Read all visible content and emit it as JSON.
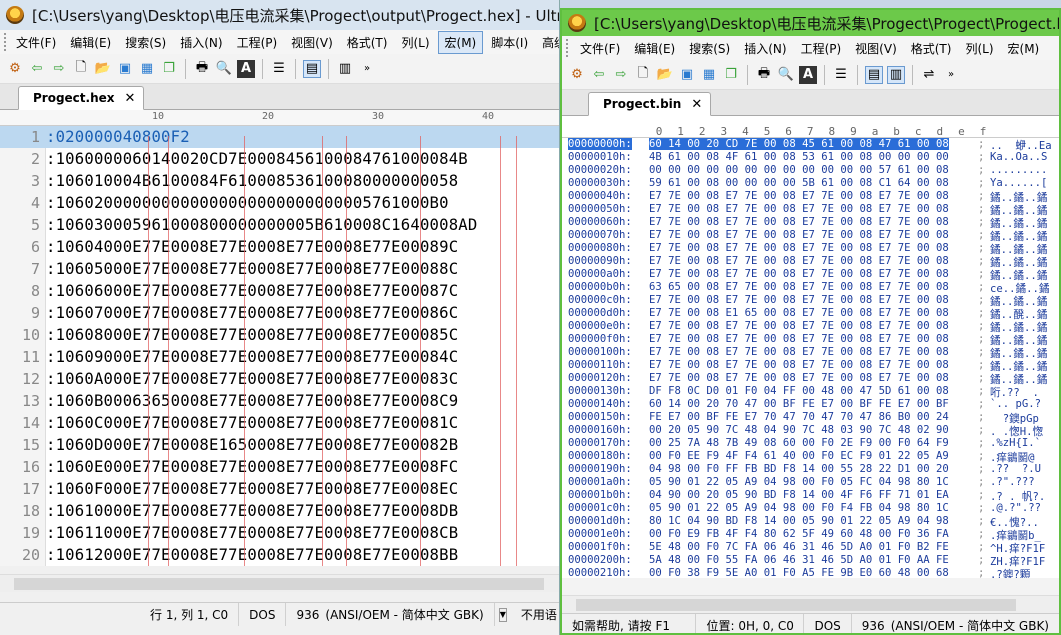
{
  "win1": {
    "title": "[C:\\Users\\yang\\Desktop\\电压电流采集\\Progect\\output\\Progect.hex] - Ultra",
    "menu": [
      "文件(F)",
      "编辑(E)",
      "搜索(S)",
      "插入(N)",
      "工程(P)",
      "视图(V)",
      "格式(T)",
      "列(L)",
      "宏(M)",
      "脚本(I)",
      "高级"
    ],
    "tab": "Progect.hex",
    "ruler": [
      "10",
      "20",
      "30",
      "40"
    ],
    "lines": [
      {
        "n": "1",
        "t": ":020000040800F2"
      },
      {
        "n": "2",
        "t": ":1060000060140020CD7E0008456100084761000084B"
      },
      {
        "n": "3",
        "t": ":106010004B6100084F610008536100080000000058"
      },
      {
        "n": "4",
        "t": ":106020000000000000000000000000005761000B0"
      },
      {
        "n": "5",
        "t": ":106030005961000800000000005B610008C1640008AD"
      },
      {
        "n": "6",
        "t": ":10604000E77E0008E77E0008E77E0008E77E00089C"
      },
      {
        "n": "7",
        "t": ":10605000E77E0008E77E0008E77E0008E77E00088C"
      },
      {
        "n": "8",
        "t": ":10606000E77E0008E77E0008E77E0008E77E00087C"
      },
      {
        "n": "9",
        "t": ":10607000E77E0008E77E0008E77E0008E77E00086C"
      },
      {
        "n": "10",
        "t": ":10608000E77E0008E77E0008E77E0008E77E00085C"
      },
      {
        "n": "11",
        "t": ":10609000E77E0008E77E0008E77E0008E77E00084C"
      },
      {
        "n": "12",
        "t": ":1060A000E77E0008E77E0008E77E0008E77E00083C"
      },
      {
        "n": "13",
        "t": ":1060B00063650008E77E0008E77E0008E77E0008C9"
      },
      {
        "n": "14",
        "t": ":1060C000E77E0008E77E0008E77E0008E77E00081C"
      },
      {
        "n": "15",
        "t": ":1060D000E77E0008E1650008E77E0008E77E00082B"
      },
      {
        "n": "16",
        "t": ":1060E000E77E0008E77E0008E77E0008E77E0008FC"
      },
      {
        "n": "17",
        "t": ":1060F000E77E0008E77E0008E77E0008E77E0008EC"
      },
      {
        "n": "18",
        "t": ":10610000E77E0008E77E0008E77E0008E77E0008DB"
      },
      {
        "n": "19",
        "t": ":10611000E77E0008E77E0008E77E0008E77E0008CB"
      },
      {
        "n": "20",
        "t": ":10612000E77E0008E77E0008E77E0008E77E0008BB"
      }
    ],
    "status": {
      "pos": "行 1, 列 1, C0",
      "format": "DOS",
      "codepage": "936",
      "encoding": "(ANSI/OEM - 简体中文 GBK)",
      "extra": "不用语"
    }
  },
  "win2": {
    "title": "[C:\\Users\\yang\\Desktop\\电压电流采集\\Progect\\Progect\\Progect.b",
    "menu": [
      "文件(F)",
      "编辑(E)",
      "搜索(S)",
      "插入(N)",
      "工程(P)",
      "视图(V)",
      "格式(T)",
      "列(L)",
      "宏(M)"
    ],
    "tab": "Progect.bin",
    "cols": [
      "0",
      "1",
      "2",
      "3",
      "4",
      "5",
      "6",
      "7",
      "8",
      "9",
      "a",
      "b",
      "c",
      "d",
      "e",
      "f"
    ],
    "rows": [
      {
        "a": "00000000h:",
        "b": "60 14 00 20 CD 7E 00 08 45 61 00 08 47 61 00 08",
        "s": "..  蛜..Ea"
      },
      {
        "a": "00000010h:",
        "b": "4B 61 00 08 4F 61 00 08 53 61 00 08 00 00 00 00",
        "s": "Ka..Oa..S"
      },
      {
        "a": "00000020h:",
        "b": "00 00 00 00 00 00 00 00 00 00 00 00 57 61 00 08",
        "s": "........."
      },
      {
        "a": "00000030h:",
        "b": "59 61 00 08 00 00 00 00 5B 61 00 08 C1 64 00 08",
        "s": "Ya......["
      },
      {
        "a": "00000040h:",
        "b": "E7 7E 00 08 E7 7E 00 08 E7 7E 00 08 E7 7E 00 08",
        "s": "鐍..鐍..鐍"
      },
      {
        "a": "00000050h:",
        "b": "E7 7E 00 08 E7 7E 00 08 E7 7E 00 08 E7 7E 00 08",
        "s": "鐍..鐍..鐍"
      },
      {
        "a": "00000060h:",
        "b": "E7 7E 00 08 E7 7E 00 08 E7 7E 00 08 E7 7E 00 08",
        "s": "鐍..鐍..鐍"
      },
      {
        "a": "00000070h:",
        "b": "E7 7E 00 08 E7 7E 00 08 E7 7E 00 08 E7 7E 00 08",
        "s": "鐍..鐍..鐍"
      },
      {
        "a": "00000080h:",
        "b": "E7 7E 00 08 E7 7E 00 08 E7 7E 00 08 E7 7E 00 08",
        "s": "鐍..鐍..鐍"
      },
      {
        "a": "00000090h:",
        "b": "E7 7E 00 08 E7 7E 00 08 E7 7E 00 08 E7 7E 00 08",
        "s": "鐍..鐍..鐍"
      },
      {
        "a": "000000a0h:",
        "b": "E7 7E 00 08 E7 7E 00 08 E7 7E 00 08 E7 7E 00 08",
        "s": "鐍..鐍..鐍"
      },
      {
        "a": "000000b0h:",
        "b": "63 65 00 08 E7 7E 00 08 E7 7E 00 08 E7 7E 00 08",
        "s": "ce..鐍..鐍"
      },
      {
        "a": "000000c0h:",
        "b": "E7 7E 00 08 E7 7E 00 08 E7 7E 00 08 E7 7E 00 08",
        "s": "鐍..鐍..鐍"
      },
      {
        "a": "000000d0h:",
        "b": "E7 7E 00 08 E1 65 00 08 E7 7E 00 08 E7 7E 00 08",
        "s": "鐍..醗..鐍"
      },
      {
        "a": "000000e0h:",
        "b": "E7 7E 00 08 E7 7E 00 08 E7 7E 00 08 E7 7E 00 08",
        "s": "鐍..鐍..鐍"
      },
      {
        "a": "000000f0h:",
        "b": "E7 7E 00 08 E7 7E 00 08 E7 7E 00 08 E7 7E 00 08",
        "s": "鐍..鐍..鐍"
      },
      {
        "a": "00000100h:",
        "b": "E7 7E 00 08 E7 7E 00 08 E7 7E 00 08 E7 7E 00 08",
        "s": "鐍..鐍..鐍"
      },
      {
        "a": "00000110h:",
        "b": "E7 7E 00 08 E7 7E 00 08 E7 7E 00 08 E7 7E 00 08",
        "s": "鐍..鐍..鐍"
      },
      {
        "a": "00000120h:",
        "b": "E7 7E 00 08 E7 7E 00 08 E7 7E 00 08 E7 7E 00 08",
        "s": "鐍..鐍..鐍"
      },
      {
        "a": "00000130h:",
        "b": "DF F8 0C D0 01 F0 04 FF 00 48 00 47 5D 61 00 08",
        "s": "哘.??  ."
      },
      {
        "a": "00000140h:",
        "b": "60 14 00 20 70 47 00 BF FE E7 00 BF FE E7 00 BF",
        "s": "`.. pG.?"
      },
      {
        "a": "00000150h:",
        "b": "FE E7 00 BF FE E7 70 47 70 47 70 47 86 B0 00 24",
        "s": "  ?鐭pGp"
      },
      {
        "a": "00000160h:",
        "b": "00 20 05 90 7C 48 04 90 7C 48 03 90 7C 48 02 90",
        "s": ". .愡H.愡"
      },
      {
        "a": "00000170h:",
        "b": "00 25 7A 48 7B 49 08 60 00 F0 2E F9 00 F0 64 F9",
        "s": ".%zH{I.`"
      },
      {
        "a": "00000180h:",
        "b": "00 F0 EE F9 4F F4 61 40 00 F0 EC F9 01 22 05 A9",
        "s": ".痒鶲鬭@"
      },
      {
        "a": "00000190h:",
        "b": "04 98 00 F0 FF FB BD F8 14 00 55 28 22 D1 00 20",
        "s": ".??  ?.U"
      },
      {
        "a": "000001a0h:",
        "b": "05 90 01 22 05 A9 04 98 00 F0 05 FC 04 98 80 1C",
        "s": ".?\".???"
      },
      {
        "a": "000001b0h:",
        "b": "04 90 00 20 05 90 BD F8 14 00 4F F6 FF 71 01 EA",
        "s": ".? . 帆?."
      },
      {
        "a": "000001c0h:",
        "b": "05 90 01 22 05 A9 04 98 00 F0 F4 FB 04 98 80 1C",
        "s": ".@.?\".??"
      },
      {
        "a": "000001d0h:",
        "b": "80 1C 04 90 BD F8 14 00 05 90 01 22 05 A9 04 98",
        "s": "€..愧?.."
      },
      {
        "a": "000001e0h:",
        "b": "00 F0 E9 FB 4F F4 80 62 5F 49 60 48 00 F0 36 FA",
        "s": ".痒鶲鬭b_"
      },
      {
        "a": "000001f0h:",
        "b": "5E 48 00 F0 7C FA 06 46 31 46 5D A0 01 F0 B2 FE",
        "s": "^H.痒?F1F"
      },
      {
        "a": "00000200h:",
        "b": "5A 48 00 F0 55 FA 06 46 31 46 5D A0 01 F0 AA FE",
        "s": "ZH.痒?F1F"
      },
      {
        "a": "00000210h:",
        "b": "00 F0 38 F9 5E A0 01 F0 A5 FE 9B E0 60 48 00 68",
        "s": ".?鐭?顆"
      }
    ],
    "status": {
      "help": "如需帮助, 请按 F1",
      "pos": "位置: 0H, 0, C0",
      "format": "DOS",
      "codepage": "936",
      "encoding": "(ANSI/OEM - 简体中文 GBK)"
    }
  }
}
